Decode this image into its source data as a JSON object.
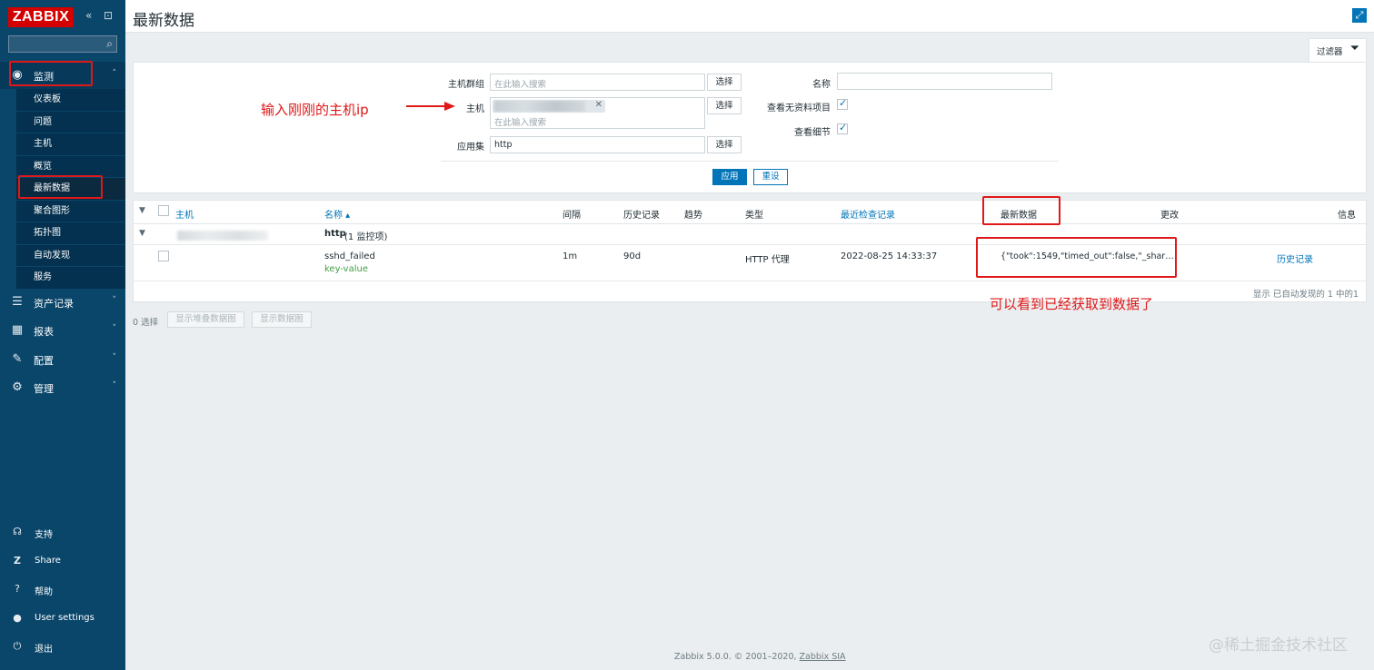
{
  "sidebar": {
    "logo": "ZABBIX",
    "collapse_icon": "«",
    "kiosk_icon": "⊡",
    "menu": [
      {
        "label": "监测",
        "icon": "eye-icon"
      },
      {
        "label": "资产记录",
        "icon": "list-icon"
      },
      {
        "label": "报表",
        "icon": "chart-icon"
      },
      {
        "label": "配置",
        "icon": "wrench-icon"
      },
      {
        "label": "管理",
        "icon": "gear-icon"
      }
    ],
    "submenu": [
      "仪表板",
      "问题",
      "主机",
      "概览",
      "最新数据",
      "聚合图形",
      "拓扑图",
      "自动发现",
      "服务"
    ],
    "bottom": [
      {
        "label": "支持",
        "icon": "headset-icon"
      },
      {
        "label": "Share",
        "icon": "share-icon"
      },
      {
        "label": "帮助",
        "icon": "help-icon"
      },
      {
        "label": "User settings",
        "icon": "user-icon"
      },
      {
        "label": "退出",
        "icon": "power-icon"
      }
    ]
  },
  "header": {
    "title": "最新数据"
  },
  "filter": {
    "tab_label": "过滤器",
    "host_group_label": "主机群组",
    "host_group_placeholder": "在此输入搜索",
    "host_label": "主机",
    "host_placeholder": "在此输入搜索",
    "app_label": "应用集",
    "app_value": "http",
    "select_label": "选择",
    "name_label": "名称",
    "name_value": "",
    "show_no_data_label": "查看无资料项目",
    "show_details_label": "查看细节",
    "apply_label": "应用",
    "reset_label": "重设"
  },
  "table": {
    "headers": {
      "host": "主机",
      "name": "名称 ▴",
      "interval": "间隔",
      "history": "历史记录",
      "trends": "趋势",
      "type": "类型",
      "last_check": "最近检查记录",
      "last_value": "最新数据",
      "change": "更改",
      "info": "信息"
    },
    "group": {
      "name": "http",
      "count": "(1 监控项)"
    },
    "rows": [
      {
        "name": "sshd_failed",
        "key": "key-value",
        "interval": "1m",
        "history": "90d",
        "type": "HTTP 代理",
        "last_check": "2022-08-25 14:33:37",
        "last_value": "{\"took\":1549,\"timed_out\":false,\"_shar…",
        "history_link": "历史记录"
      }
    ],
    "footer": "显示 已自动发现的 1 中的1"
  },
  "actions": {
    "selected": "0 选择",
    "stacked_graph": "显示堆叠数据图",
    "graph": "显示数据图"
  },
  "footer": {
    "copyright": "Zabbix 5.0.0. © 2001–2020, ",
    "company": "Zabbix SIA"
  },
  "watermark": "@稀土掘金技术社区",
  "annotations": {
    "host_hint": "输入刚刚的主机ip",
    "data_hint": "可以看到已经获取到数据了",
    "color": "#e01818"
  }
}
